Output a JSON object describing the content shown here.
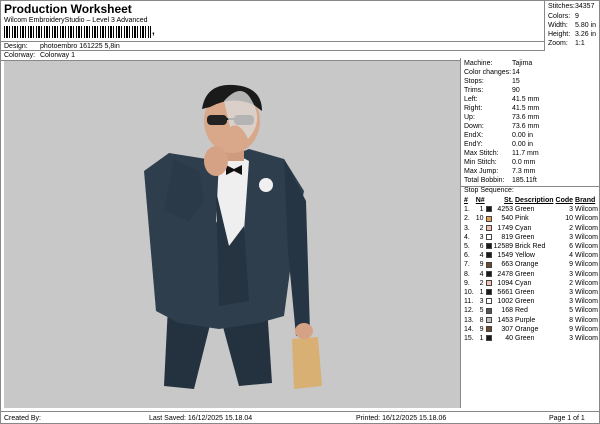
{
  "header": {
    "title": "Production Worksheet",
    "subtitle": "Wilcom EmbroideryStudio – Level 3 Advanced",
    "barcode_suffix": ",",
    "design_label": "Design:",
    "design_value": "photoembro 161225 5,8in",
    "colorway_label": "Colorway:",
    "colorway_value": "Colorway 1"
  },
  "stats": [
    {
      "label": "Stitches:",
      "value": "34357"
    },
    {
      "label": "Colors:",
      "value": "9"
    },
    {
      "label": "Width:",
      "value": "5.80 in"
    },
    {
      "label": "Height:",
      "value": "3.26 in"
    },
    {
      "label": "Zoom:",
      "value": "1:1"
    }
  ],
  "info": [
    {
      "label": "Machine:",
      "value": "Tajima"
    },
    {
      "label": "Color changes:",
      "value": "14"
    },
    {
      "label": "Stops:",
      "value": "15"
    },
    {
      "label": "Trims:",
      "value": "90"
    },
    {
      "label": "Left:",
      "value": "41.5 mm"
    },
    {
      "label": "Right:",
      "value": "41.5 mm"
    },
    {
      "label": "Up:",
      "value": "73.6 mm"
    },
    {
      "label": "Down:",
      "value": "73.6 mm"
    },
    {
      "label": "EndX:",
      "value": "0.00 in"
    },
    {
      "label": "EndY:",
      "value": "0.00 in"
    },
    {
      "label": "Max Stitch:",
      "value": "11.7 mm"
    },
    {
      "label": "Min Stitch:",
      "value": "0.0 mm"
    },
    {
      "label": "Max Jump:",
      "value": "7.3 mm"
    },
    {
      "label": "Total Bobbin:",
      "value": "185.11ft"
    }
  ],
  "sequence": {
    "heading": "Stop Sequence:",
    "columns": [
      "#",
      "N#",
      "St.",
      "Description",
      "Code",
      "Brand"
    ],
    "rows": [
      {
        "idx": "1.",
        "n": "1",
        "color": "#1a1a1a",
        "st": "4253",
        "desc": "Green",
        "code": "3",
        "brand": "Wilcom"
      },
      {
        "idx": "2.",
        "n": "10",
        "color": "#e8a050",
        "st": "540",
        "desc": "Pink",
        "code": "10",
        "brand": "Wilcom"
      },
      {
        "idx": "3.",
        "n": "2",
        "color": "#f0c0b0",
        "st": "1749",
        "desc": "Cyan",
        "code": "2",
        "brand": "Wilcom"
      },
      {
        "idx": "4.",
        "n": "3",
        "color": "#ffffff",
        "st": "819",
        "desc": "Green",
        "code": "3",
        "brand": "Wilcom"
      },
      {
        "idx": "5.",
        "n": "6",
        "color": "#1a1a1a",
        "st": "12589",
        "desc": "Brick Red",
        "code": "6",
        "brand": "Wilcom"
      },
      {
        "idx": "6.",
        "n": "4",
        "color": "#1a1a1a",
        "st": "1549",
        "desc": "Yellow",
        "code": "4",
        "brand": "Wilcom"
      },
      {
        "idx": "7.",
        "n": "9",
        "color": "#6a4a30",
        "st": "663",
        "desc": "Orange",
        "code": "9",
        "brand": "Wilcom"
      },
      {
        "idx": "8.",
        "n": "4",
        "color": "#1a1a1a",
        "st": "2478",
        "desc": "Green",
        "code": "3",
        "brand": "Wilcom"
      },
      {
        "idx": "9.",
        "n": "2",
        "color": "#f0c0b0",
        "st": "1094",
        "desc": "Cyan",
        "code": "2",
        "brand": "Wilcom"
      },
      {
        "idx": "10.",
        "n": "1",
        "color": "#1a1a1a",
        "st": "5661",
        "desc": "Green",
        "code": "3",
        "brand": "Wilcom"
      },
      {
        "idx": "11.",
        "n": "3",
        "color": "#ffffff",
        "st": "1002",
        "desc": "Green",
        "code": "3",
        "brand": "Wilcom"
      },
      {
        "idx": "12.",
        "n": "5",
        "color": "#555555",
        "st": "168",
        "desc": "Red",
        "code": "5",
        "brand": "Wilcom"
      },
      {
        "idx": "13.",
        "n": "8",
        "color": "#c0c0c0",
        "st": "1453",
        "desc": "Purple",
        "code": "8",
        "brand": "Wilcom"
      },
      {
        "idx": "14.",
        "n": "9",
        "color": "#6a4a30",
        "st": "307",
        "desc": "Orange",
        "code": "9",
        "brand": "Wilcom"
      },
      {
        "idx": "15.",
        "n": "1",
        "color": "#1a1a1a",
        "st": "40",
        "desc": "Green",
        "code": "3",
        "brand": "Wilcom"
      }
    ]
  },
  "footer": {
    "created_by": "Created By:",
    "last_saved": "Last Saved: 16/12/2025 15.18.04",
    "printed": "Printed: 16/12/2025 15.18.06",
    "page": "Page 1 of 1"
  },
  "colors": {
    "canvas_bg": "#c8c8c8",
    "suit": "#2b3a48",
    "skin": "#d9a789",
    "shirt": "#f2f2f2"
  }
}
